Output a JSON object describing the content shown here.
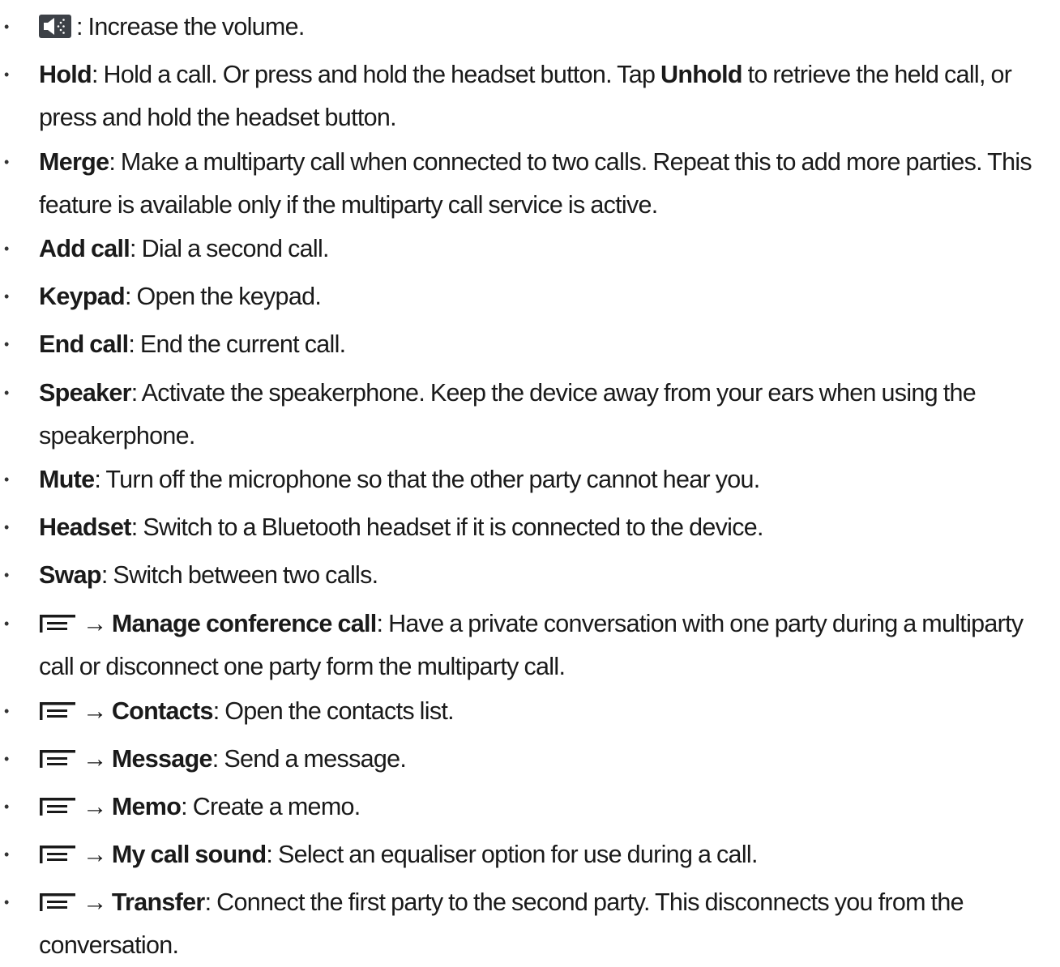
{
  "items": [
    {
      "rest": ": Increase the volume.",
      "icon": "volume-up-icon"
    },
    {
      "bold": "Hold",
      "rest": ": Hold a call. Or press and hold the headset button. Tap ",
      "bold2": "Unhold",
      "rest2": " to retrieve the held call, or press and hold the headset button."
    },
    {
      "bold": "Merge",
      "rest": ": Make a multiparty call when connected to two calls. Repeat this to add more parties. This feature is available only if the multiparty call service is active."
    },
    {
      "bold": "Add call",
      "rest": ": Dial a second call."
    },
    {
      "bold": "Keypad",
      "rest": ": Open the keypad."
    },
    {
      "bold": "End call",
      "rest": ": End the current call."
    },
    {
      "bold": "Speaker",
      "rest": ": Activate the speakerphone. Keep the device away from your ears when using the speakerphone."
    },
    {
      "bold": "Mute",
      "rest": ": Turn off the microphone so that the other party cannot hear you."
    },
    {
      "bold": "Headset",
      "rest": ": Switch to a Bluetooth headset if it is connected to the device."
    },
    {
      "bold": "Swap",
      "rest": ": Switch between two calls."
    },
    {
      "arrow": "→",
      "bold": "Manage conference call",
      "rest": ": Have a private conversation with one party during a multiparty call or disconnect one party form the multiparty call.",
      "icon": "menu-icon"
    },
    {
      "arrow": "→",
      "bold": "Contacts",
      "rest": ": Open the contacts list.",
      "icon": "menu-icon"
    },
    {
      "arrow": "→",
      "bold": "Message",
      "rest": ": Send a message.",
      "icon": "menu-icon"
    },
    {
      "arrow": "→",
      "bold": "Memo",
      "rest": ": Create a memo.",
      "icon": "menu-icon"
    },
    {
      "arrow": "→",
      "bold": "My call sound",
      "rest": ": Select an equaliser option for use during a call.",
      "icon": "menu-icon"
    },
    {
      "arrow": "→",
      "bold": "Transfer",
      "rest": ": Connect the first party to the second party. This disconnects you from the conversation.",
      "icon": "menu-icon"
    }
  ]
}
